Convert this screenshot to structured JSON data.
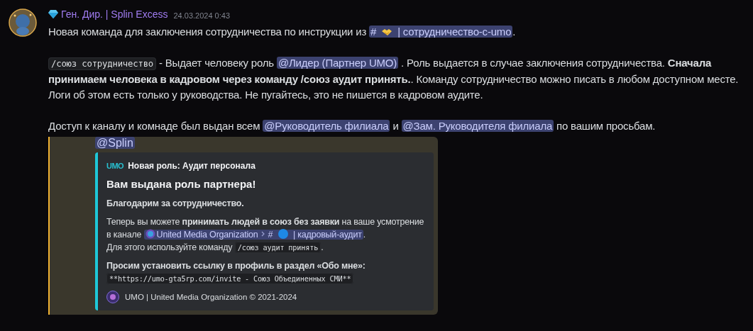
{
  "message": {
    "author": "Ген. Дир. | Splin Excess",
    "timestamp": "24.03.2024 0:43",
    "paragraphs": [
      [
        {
          "kind": "text",
          "text": "Новая команда для заключения сотрудничества по инструкции из "
        },
        {
          "kind": "channel",
          "prefix": "#",
          "name": "| сотрудничество-с-umo"
        },
        {
          "kind": "text",
          "text": "."
        }
      ],
      [
        {
          "kind": "code",
          "text": "/союз сотрудничество"
        },
        {
          "kind": "text",
          "text": " - Выдает человеку роль "
        },
        {
          "kind": "mention",
          "text": "@Лидер (Партнер UMO)"
        },
        {
          "kind": "text",
          "text": " . Роль выдается в случае заключения сотрудничества. "
        },
        {
          "kind": "bold",
          "text": "Сначала принимаем человека в кадровом через команду /союз аудит принять."
        },
        {
          "kind": "text",
          "text": ". Команду сотрудничество можно писать в любом доступном месте. Логи об этом есть только у руководства. Не пугайтесь, это не пишется в кадровом аудите."
        }
      ],
      [
        {
          "kind": "text",
          "text": "Доступ к каналу и комнаде был выдан всем "
        },
        {
          "kind": "mention",
          "text": "@Руководитель филиала"
        },
        {
          "kind": "text",
          "text": " и "
        },
        {
          "kind": "mention",
          "text": "@Зам. Руководителя филиала"
        },
        {
          "kind": "text",
          "text": " по вашим просьбам."
        }
      ]
    ]
  },
  "reply": {
    "mention": "@Splin",
    "embed": {
      "author_logo": "UMO",
      "author": "Новая роль: Аудит персонала",
      "title": "Вам выдана роль партнера!",
      "blocks": [
        [
          {
            "kind": "bold",
            "text": "Благодарим за сотрудничество."
          }
        ],
        [
          {
            "kind": "text",
            "text": "Теперь вы можете "
          },
          {
            "kind": "bold",
            "text": "принимать людей в союз без заявки"
          },
          {
            "kind": "text",
            "text": " на ваше усмотрение в канале "
          },
          {
            "kind": "channel",
            "server": "United Media Organization",
            "prefix": "#",
            "name": "| кадровый-аудит"
          },
          {
            "kind": "text",
            "text": "."
          },
          {
            "kind": "break"
          },
          {
            "kind": "text",
            "text": "Для этого используйте команду "
          },
          {
            "kind": "code",
            "text": "/союз аудит принять"
          },
          {
            "kind": "text",
            "text": "."
          }
        ],
        [
          {
            "kind": "bold",
            "text": "Просим установить ссылку в профиль в раздел «Обо мне»:"
          },
          {
            "kind": "break"
          },
          {
            "kind": "code",
            "text": "**https://umo-gta5rp.com/invite - Союз Объединенных СМИ**"
          }
        ]
      ],
      "footer": "UMO | United Media Organization © 2021-2024"
    }
  }
}
